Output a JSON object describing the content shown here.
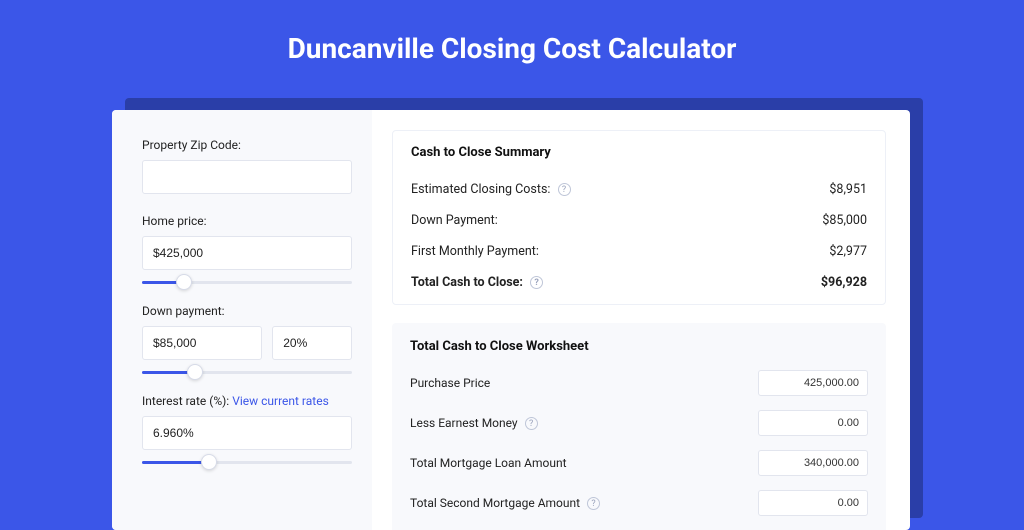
{
  "page_title": "Duncanville Closing Cost Calculator",
  "left": {
    "zip_label": "Property Zip Code:",
    "zip_value": "",
    "home_price_label": "Home price:",
    "home_price_value": "$425,000",
    "home_price_slider_pct": 20,
    "down_payment_label": "Down payment:",
    "down_payment_amount": "$85,000",
    "down_payment_pct": "20%",
    "down_payment_slider_pct": 25,
    "interest_label_prefix": "Interest rate (%): ",
    "interest_link": "View current rates",
    "interest_value": "6.960%",
    "interest_slider_pct": 32
  },
  "summary": {
    "title": "Cash to Close Summary",
    "rows": [
      {
        "label": "Estimated Closing Costs:",
        "help": true,
        "value": "$8,951"
      },
      {
        "label": "Down Payment:",
        "help": false,
        "value": "$85,000"
      },
      {
        "label": "First Monthly Payment:",
        "help": false,
        "value": "$2,977"
      }
    ],
    "total_label": "Total Cash to Close:",
    "total_value": "$96,928"
  },
  "worksheet": {
    "title": "Total Cash to Close Worksheet",
    "rows": [
      {
        "label": "Purchase Price",
        "help": false,
        "value": "425,000.00"
      },
      {
        "label": "Less Earnest Money",
        "help": true,
        "value": "0.00"
      },
      {
        "label": "Total Mortgage Loan Amount",
        "help": false,
        "value": "340,000.00"
      },
      {
        "label": "Total Second Mortgage Amount",
        "help": true,
        "value": "0.00"
      }
    ]
  }
}
